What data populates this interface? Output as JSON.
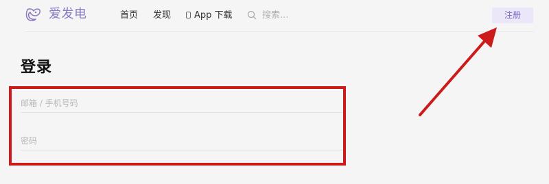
{
  "header": {
    "logo_text": "爱发电",
    "logo_icon": "fox-logo-icon",
    "nav": [
      {
        "label": "首页"
      },
      {
        "label": "发现"
      },
      {
        "label": "App 下载",
        "icon": "phone-icon"
      }
    ],
    "search_placeholder": "搜索...",
    "register_label": "注册"
  },
  "main": {
    "title": "登录",
    "fields": [
      {
        "placeholder": "邮箱 / 手机号码"
      },
      {
        "placeholder": "密码"
      }
    ]
  },
  "colors": {
    "brand": "#8a7bc6",
    "register_bg": "#ece7f8",
    "annotation": "#cc1b1b",
    "background": "#f5f5f5"
  }
}
